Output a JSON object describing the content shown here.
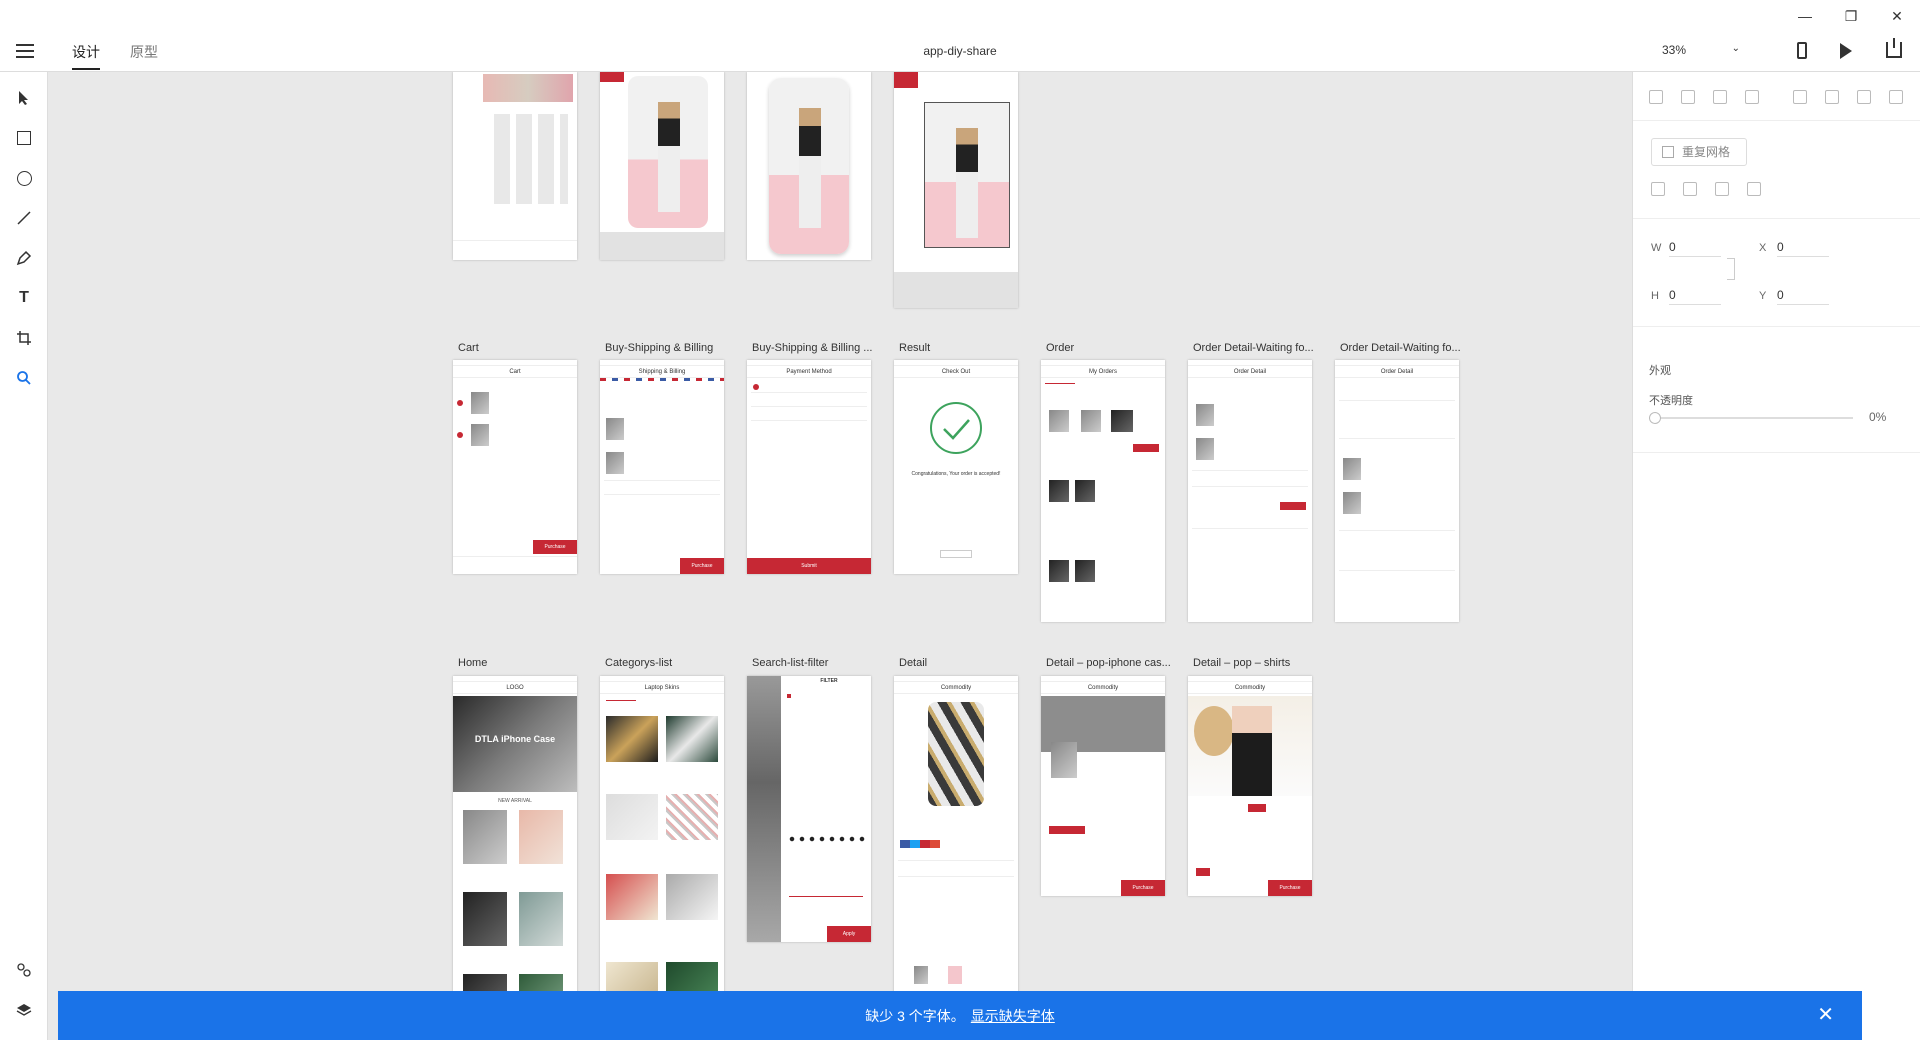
{
  "window": {
    "controls": [
      "—",
      "❐",
      "✕"
    ]
  },
  "topbar": {
    "menu_icon": "hamburger-icon",
    "tabs": [
      {
        "label": "设计"
      },
      {
        "label": "原型"
      }
    ],
    "doc_title": "app-diy-share",
    "zoom": "33%",
    "icons": [
      "mobile-preview-icon",
      "play-icon",
      "share-icon"
    ]
  },
  "tools": [
    "select-arrow-icon",
    "rectangle-icon",
    "ellipse-icon",
    "line-icon",
    "pen-icon",
    "text-icon",
    "artboard-icon",
    "zoom-icon",
    "assets-icon",
    "layers-icon"
  ],
  "rightpanel": {
    "repeat_grid": "重复网格",
    "w_label": "W",
    "w_value": "0",
    "x_label": "X",
    "x_value": "0",
    "h_label": "H",
    "h_value": "0",
    "y_label": "Y",
    "y_value": "0",
    "appearance": "外观",
    "opacity_label": "不透明度",
    "opacity_value": "0%"
  },
  "artboards": {
    "row2": [
      {
        "label": "Cart",
        "title": "Cart"
      },
      {
        "label": "Buy-Shipping & Billing",
        "title": "Shipping & Billing"
      },
      {
        "label": "Buy-Shipping & Billing ...",
        "title": "Payment Method"
      },
      {
        "label": "Result",
        "title": "Check Out"
      },
      {
        "label": "Order",
        "title": "My Orders"
      },
      {
        "label": "Order Detail-Waiting fo...",
        "title": "Order Detail"
      },
      {
        "label": "Order Detail-Waiting fo...",
        "title": "Order Detail"
      }
    ],
    "row3": [
      {
        "label": "Home",
        "title": "LOGO"
      },
      {
        "label": "Categorys-list",
        "title": "Laptop Skins"
      },
      {
        "label": "Search-list-filter",
        "title": "FILTER"
      },
      {
        "label": "Detail",
        "title": "Commodity"
      },
      {
        "label": "Detail – pop-iphone cas...",
        "title": "Commodity"
      },
      {
        "label": "Detail – pop – shirts",
        "title": "Commodity"
      }
    ],
    "result_text": "Congratulations, Your order is accepted!",
    "purchase": "Purchase",
    "submit": "Submit",
    "apply": "Apply",
    "home_banner": "DTLA iPhone Case",
    "new_arrival": "NEW ARRIVAL"
  },
  "banner": {
    "text": "缺少 3 个字体。",
    "link": "显示缺失字体",
    "close_icon": "close-icon"
  }
}
